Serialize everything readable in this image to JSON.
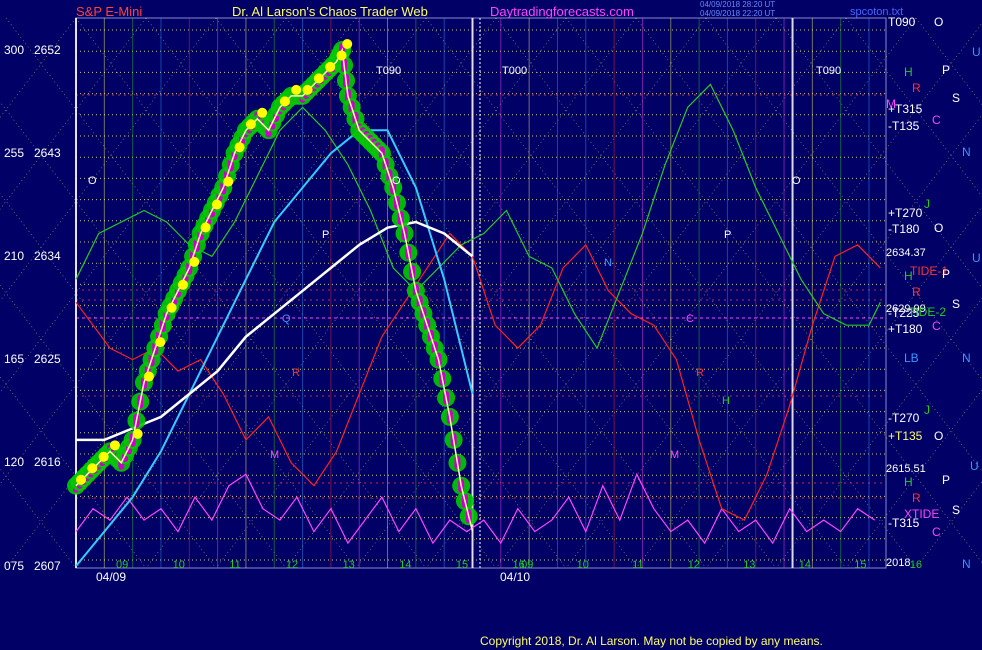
{
  "header": {
    "left": "S&P E-Mini",
    "middle": "Dr. Al Larson's Chaos Trader Web",
    "site": "Daytradingforecasts.com",
    "right": "spcoton.txt",
    "timestamp_line1": "04/09/2018 28:20 UT",
    "timestamp_line2": "04/09/2018 22:20 UT"
  },
  "footer": {
    "copyright": "Copyright 2018, Dr. Al Larson. May not be copied by any means."
  },
  "dates": {
    "left": "04/09",
    "right": "04/10"
  },
  "colors": {
    "background": "#000066",
    "price_green": "#00cc00",
    "price_yellow": "#ffff00",
    "price_magenta": "#cc00cc",
    "cyan_avg": "#33ccff",
    "white_avg": "#ffffff",
    "red_tide": "#ff2020",
    "green_field": "#22cc22",
    "magenta_xtide": "#ff44ff",
    "yellow_grid": "#ffff66"
  },
  "chart_data": {
    "type": "line",
    "y_axis_left": {
      "outer_labels": [
        "300",
        "255",
        "210",
        "165",
        "120",
        "075"
      ],
      "inner_labels": [
        "2652",
        "2643",
        "2634",
        "2625",
        "2616",
        "2607"
      ],
      "ylim": [
        2607,
        2652
      ]
    },
    "x_ticks_day1": [
      "09",
      "10",
      "11",
      "12",
      "13",
      "14",
      "15",
      "16"
    ],
    "x_ticks_day2": [
      "09",
      "10",
      "11",
      "12",
      "13",
      "14",
      "15",
      "16"
    ],
    "right_labels": {
      "harmonics": [
        "T090",
        "+T315",
        "-T135",
        "+T270",
        "-T180",
        "-T225",
        "+T180",
        "-T270",
        "+T135",
        "-T315"
      ],
      "prices": [
        "2634.37",
        "2629.99",
        "2615.51",
        "2018"
      ],
      "series_tags": [
        "TIDE-1",
        "TIDE-2",
        "XTIDE"
      ],
      "letters": [
        "O",
        "H",
        "P",
        "R",
        "S",
        "M",
        "C",
        "N",
        "U",
        "J",
        "LB"
      ]
    },
    "chart_annotations": [
      "T090",
      "T000",
      "T090",
      "O",
      "O",
      "O",
      "P",
      "P",
      "R",
      "R",
      "Q",
      "H",
      "M",
      "M",
      "N",
      "C"
    ],
    "series": [
      {
        "kind": "price",
        "points": [
          [
            9.0,
            2614
          ],
          [
            9.2,
            2615
          ],
          [
            9.4,
            2616
          ],
          [
            9.6,
            2617
          ],
          [
            9.8,
            2616
          ],
          [
            10.0,
            2618
          ],
          [
            10.2,
            2623
          ],
          [
            10.4,
            2626
          ],
          [
            10.6,
            2629
          ],
          [
            10.8,
            2631
          ],
          [
            11.0,
            2633
          ],
          [
            11.2,
            2636
          ],
          [
            11.4,
            2638
          ],
          [
            11.6,
            2640
          ],
          [
            11.8,
            2643
          ],
          [
            12.0,
            2645
          ],
          [
            12.2,
            2646
          ],
          [
            12.4,
            2645
          ],
          [
            12.6,
            2647
          ],
          [
            12.8,
            2648
          ],
          [
            13.0,
            2648
          ],
          [
            13.2,
            2649
          ],
          [
            13.4,
            2650
          ],
          [
            13.6,
            2651
          ],
          [
            13.7,
            2652
          ],
          [
            13.8,
            2648
          ],
          [
            14.0,
            2645
          ],
          [
            14.2,
            2644
          ],
          [
            14.4,
            2643
          ],
          [
            14.6,
            2640
          ],
          [
            14.8,
            2636
          ],
          [
            15.0,
            2631
          ],
          [
            15.2,
            2628
          ],
          [
            15.4,
            2625
          ],
          [
            15.6,
            2620
          ],
          [
            15.8,
            2614
          ],
          [
            16.0,
            2610
          ]
        ]
      },
      {
        "kind": "cyan_average",
        "points": [
          [
            9.0,
            2607
          ],
          [
            9.5,
            2610
          ],
          [
            10.0,
            2613
          ],
          [
            10.5,
            2617
          ],
          [
            11.0,
            2622
          ],
          [
            11.5,
            2627
          ],
          [
            12.0,
            2632
          ],
          [
            12.5,
            2637
          ],
          [
            13.0,
            2640
          ],
          [
            13.5,
            2643
          ],
          [
            14.0,
            2645
          ],
          [
            14.5,
            2645
          ],
          [
            15.0,
            2640
          ],
          [
            15.5,
            2632
          ],
          [
            16.0,
            2622
          ]
        ]
      },
      {
        "kind": "white_average",
        "points": [
          [
            9.0,
            2618
          ],
          [
            9.5,
            2618
          ],
          [
            10.0,
            2619
          ],
          [
            10.5,
            2620
          ],
          [
            11.0,
            2622
          ],
          [
            11.5,
            2624
          ],
          [
            12.0,
            2627
          ],
          [
            12.5,
            2629
          ],
          [
            13.0,
            2631
          ],
          [
            13.5,
            2633
          ],
          [
            14.0,
            2635
          ],
          [
            14.5,
            2636.5
          ],
          [
            15.0,
            2637
          ],
          [
            15.5,
            2636
          ],
          [
            16.0,
            2634
          ]
        ]
      },
      {
        "kind": "red_tide",
        "points": [
          [
            9.0,
            2630
          ],
          [
            9.3,
            2628
          ],
          [
            9.6,
            2626
          ],
          [
            10.0,
            2625
          ],
          [
            10.4,
            2626
          ],
          [
            10.8,
            2624
          ],
          [
            11.2,
            2625
          ],
          [
            11.6,
            2622
          ],
          [
            12.0,
            2618
          ],
          [
            12.4,
            2620
          ],
          [
            12.8,
            2616
          ],
          [
            13.2,
            2614
          ],
          [
            13.6,
            2617
          ],
          [
            14.0,
            2622
          ],
          [
            14.4,
            2627
          ],
          [
            14.8,
            2630
          ],
          [
            15.2,
            2633
          ],
          [
            15.6,
            2636
          ],
          [
            16.0,
            2634
          ],
          [
            16.4,
            2628
          ],
          [
            16.8,
            2626
          ],
          [
            17.2,
            2628
          ],
          [
            17.6,
            2633
          ],
          [
            18.0,
            2635
          ],
          [
            18.4,
            2631
          ],
          [
            18.8,
            2629
          ],
          [
            19.2,
            2628
          ],
          [
            19.6,
            2625
          ],
          [
            20.0,
            2618
          ],
          [
            20.4,
            2612
          ],
          [
            20.8,
            2611
          ],
          [
            21.2,
            2615
          ],
          [
            21.6,
            2621
          ],
          [
            22.0,
            2628
          ],
          [
            22.4,
            2634
          ],
          [
            22.8,
            2635
          ],
          [
            23.2,
            2633
          ]
        ]
      },
      {
        "kind": "green_field",
        "points": [
          [
            9.0,
            2632
          ],
          [
            9.4,
            2636
          ],
          [
            9.8,
            2637
          ],
          [
            10.2,
            2638
          ],
          [
            10.6,
            2637
          ],
          [
            11.0,
            2635
          ],
          [
            11.4,
            2634
          ],
          [
            11.8,
            2637
          ],
          [
            12.2,
            2641
          ],
          [
            12.6,
            2645
          ],
          [
            13.0,
            2647
          ],
          [
            13.4,
            2645
          ],
          [
            13.8,
            2642
          ],
          [
            14.2,
            2638
          ],
          [
            14.6,
            2633
          ],
          [
            15.0,
            2631
          ],
          [
            15.4,
            2633
          ],
          [
            15.8,
            2635
          ],
          [
            16.2,
            2636
          ],
          [
            16.6,
            2638
          ],
          [
            17.0,
            2634
          ],
          [
            17.4,
            2633
          ],
          [
            17.8,
            2629
          ],
          [
            18.2,
            2626
          ],
          [
            18.6,
            2631
          ],
          [
            19.0,
            2636
          ],
          [
            19.4,
            2642
          ],
          [
            19.8,
            2647
          ],
          [
            20.2,
            2649
          ],
          [
            20.6,
            2645
          ],
          [
            21.0,
            2640
          ],
          [
            21.4,
            2636
          ],
          [
            21.8,
            2632
          ],
          [
            22.2,
            2629
          ],
          [
            22.6,
            2628
          ],
          [
            23.0,
            2628
          ],
          [
            23.2,
            2630
          ]
        ]
      },
      {
        "kind": "magenta_xtide",
        "points": [
          [
            9.0,
            2610
          ],
          [
            9.3,
            2612
          ],
          [
            9.6,
            2611
          ],
          [
            9.9,
            2613
          ],
          [
            10.2,
            2611
          ],
          [
            10.5,
            2612
          ],
          [
            10.8,
            2610
          ],
          [
            11.1,
            2613
          ],
          [
            11.4,
            2611
          ],
          [
            11.7,
            2614
          ],
          [
            12.0,
            2615
          ],
          [
            12.3,
            2612
          ],
          [
            12.6,
            2611
          ],
          [
            12.9,
            2613
          ],
          [
            13.2,
            2610
          ],
          [
            13.5,
            2612
          ],
          [
            13.8,
            2609
          ],
          [
            14.1,
            2611
          ],
          [
            14.4,
            2613
          ],
          [
            14.7,
            2610
          ],
          [
            15.0,
            2612
          ],
          [
            15.3,
            2609
          ],
          [
            15.6,
            2611
          ],
          [
            15.9,
            2610
          ],
          [
            16.2,
            2611
          ],
          [
            16.5,
            2609
          ],
          [
            16.8,
            2612
          ],
          [
            17.1,
            2610
          ],
          [
            17.4,
            2611
          ],
          [
            17.7,
            2613
          ],
          [
            18.0,
            2610
          ],
          [
            18.3,
            2614
          ],
          [
            18.6,
            2611
          ],
          [
            18.9,
            2615
          ],
          [
            19.2,
            2612
          ],
          [
            19.5,
            2610
          ],
          [
            19.8,
            2611
          ],
          [
            20.1,
            2609
          ],
          [
            20.4,
            2612
          ],
          [
            20.7,
            2610
          ],
          [
            21.0,
            2611
          ],
          [
            21.3,
            2609
          ],
          [
            21.6,
            2612
          ],
          [
            21.9,
            2610
          ],
          [
            22.2,
            2611
          ],
          [
            22.5,
            2610
          ],
          [
            22.8,
            2612
          ],
          [
            23.1,
            2611
          ]
        ]
      }
    ]
  }
}
